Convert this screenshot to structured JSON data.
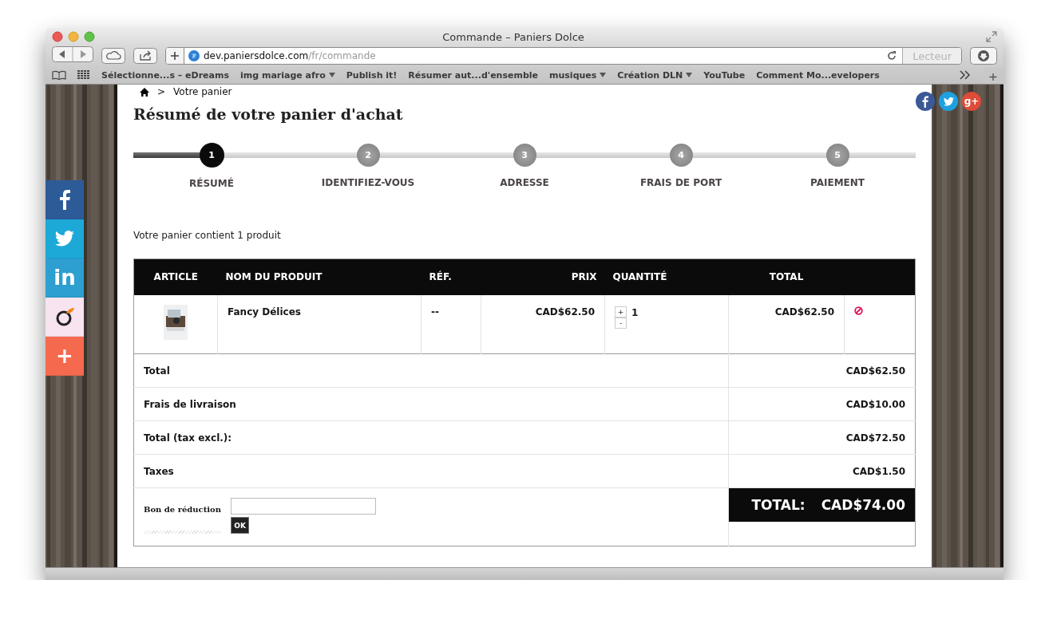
{
  "window": {
    "title": "Commande – Paniers Dolce"
  },
  "address_bar": {
    "host": "dev.paniersdolce.com",
    "path": "/fr/commande",
    "reader_button": {
      "label": "Lecteur",
      "disabled": true
    }
  },
  "bookmarks": [
    {
      "label": "Sélectionne...s – eDreams",
      "dropdown": false
    },
    {
      "label": "img mariage afro",
      "dropdown": true
    },
    {
      "label": "Publish it!",
      "dropdown": false
    },
    {
      "label": "Résumer aut...d'ensemble",
      "dropdown": false
    },
    {
      "label": "musiques",
      "dropdown": true
    },
    {
      "label": "Création DLN",
      "dropdown": true
    },
    {
      "label": "YouTube",
      "dropdown": false
    },
    {
      "label": "Comment Mo...evelopers",
      "dropdown": false
    }
  ],
  "social_sidebar": [
    {
      "kind": "facebook",
      "color": "#2d5b98"
    },
    {
      "kind": "twitter",
      "color": "#1da9d8"
    },
    {
      "kind": "linkedin",
      "glyph": "in",
      "color": "#2d9fd0"
    },
    {
      "kind": "ring",
      "color": "#f7e4f0"
    },
    {
      "kind": "plus",
      "glyph": "+",
      "color": "#f56a4f"
    }
  ],
  "share_icons": [
    {
      "kind": "facebook",
      "color": "#3b5998"
    },
    {
      "kind": "twitter",
      "color": "#1da1e0"
    },
    {
      "kind": "googleplus",
      "glyph": "g+",
      "color": "#dd4b39"
    }
  ],
  "breadcrumb": {
    "current": "Votre panier",
    "separator": ">"
  },
  "page_title": "Résumé de votre panier d'achat",
  "steps": [
    {
      "number": "1",
      "label": "RÉSUMÉ",
      "selected": true
    },
    {
      "number": "2",
      "label": "IDENTIFIEZ-VOUS",
      "selected": false
    },
    {
      "number": "3",
      "label": "ADRESSE",
      "selected": false
    },
    {
      "number": "4",
      "label": "FRAIS DE PORT",
      "selected": false
    },
    {
      "number": "5",
      "label": "PAIEMENT",
      "selected": false
    }
  ],
  "cart_summary": "Votre panier contient 1 produit",
  "table": {
    "columns": [
      "ARTICLE",
      "NOM DU PRODUIT",
      "RÉF.",
      "PRIX",
      "QUANTITÉ",
      "TOTAL"
    ],
    "rows": [
      {
        "name": "Fancy Délices",
        "ref": "--",
        "price": "CAD$62.50",
        "quantity": "1",
        "plus": "+",
        "minus": "-",
        "total": "CAD$62.50"
      }
    ]
  },
  "totals": [
    {
      "label": "Total",
      "value": "CAD$62.50"
    },
    {
      "label": "Frais de livraison",
      "value": "CAD$10.00"
    },
    {
      "label": "Total (tax excl.):",
      "value": "CAD$72.50"
    },
    {
      "label": "Taxes",
      "value": "CAD$1.50"
    }
  ],
  "voucher": {
    "label": "Bon de réduction",
    "button": "OK"
  },
  "grand_total": {
    "label": "TOTAL:",
    "value": "CAD$74.00"
  }
}
